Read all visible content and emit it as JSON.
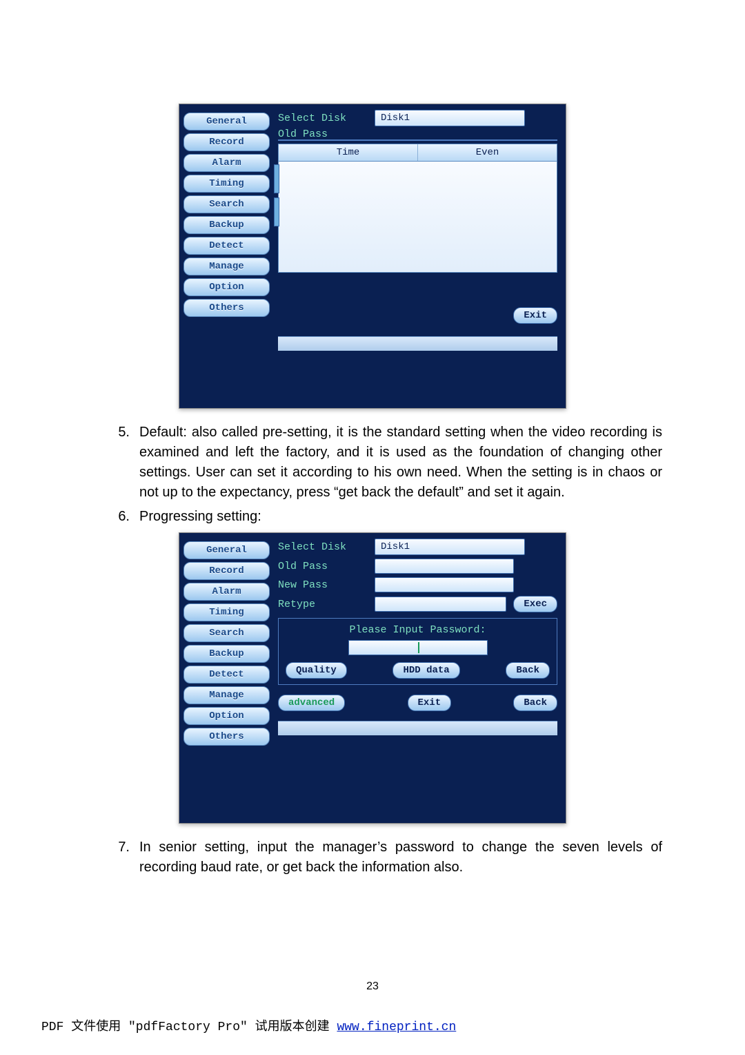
{
  "tabs": [
    "General",
    "Record",
    "Alarm",
    "Timing",
    "Search",
    "Backup",
    "Detect",
    "Manage",
    "Option",
    "Others"
  ],
  "shot1": {
    "select_disk_label": "Select Disk",
    "select_disk_value": "Disk1",
    "old_pass_truncated": "Old Pass",
    "table_headers": [
      "Time",
      "Even"
    ],
    "exit": "Exit"
  },
  "shot2": {
    "select_disk_label": "Select Disk",
    "select_disk_value": "Disk1",
    "old_pass": "Old Pass",
    "new_pass": "New Pass",
    "retype": "Retype",
    "exec": "Exec",
    "prompt": "Please Input Password:",
    "quality": "Quality",
    "hdd_data": "HDD data",
    "back": "Back",
    "advanced": "advanced",
    "exit": "Exit"
  },
  "body": {
    "item5_num": "5.",
    "item5_text": "Default: also called pre-setting, it is the standard setting when the video recording is examined and left the factory, and it is used as the foundation of changing other settings. User can set it according to his own need. When the setting is in chaos or not up to the expectancy, press “get back the default” and set it again.",
    "item6_num": "6.",
    "item6_text": "Progressing setting:",
    "item7_num": "7.",
    "item7_text": "In senior setting, input the manager’s password to change the seven levels of recording baud rate, or get back the information also."
  },
  "page_number": "23",
  "footer": {
    "prefix": "PDF 文件使用 \"pdfFactory Pro\" 试用版本创建 ",
    "link": "www.fineprint.cn"
  }
}
